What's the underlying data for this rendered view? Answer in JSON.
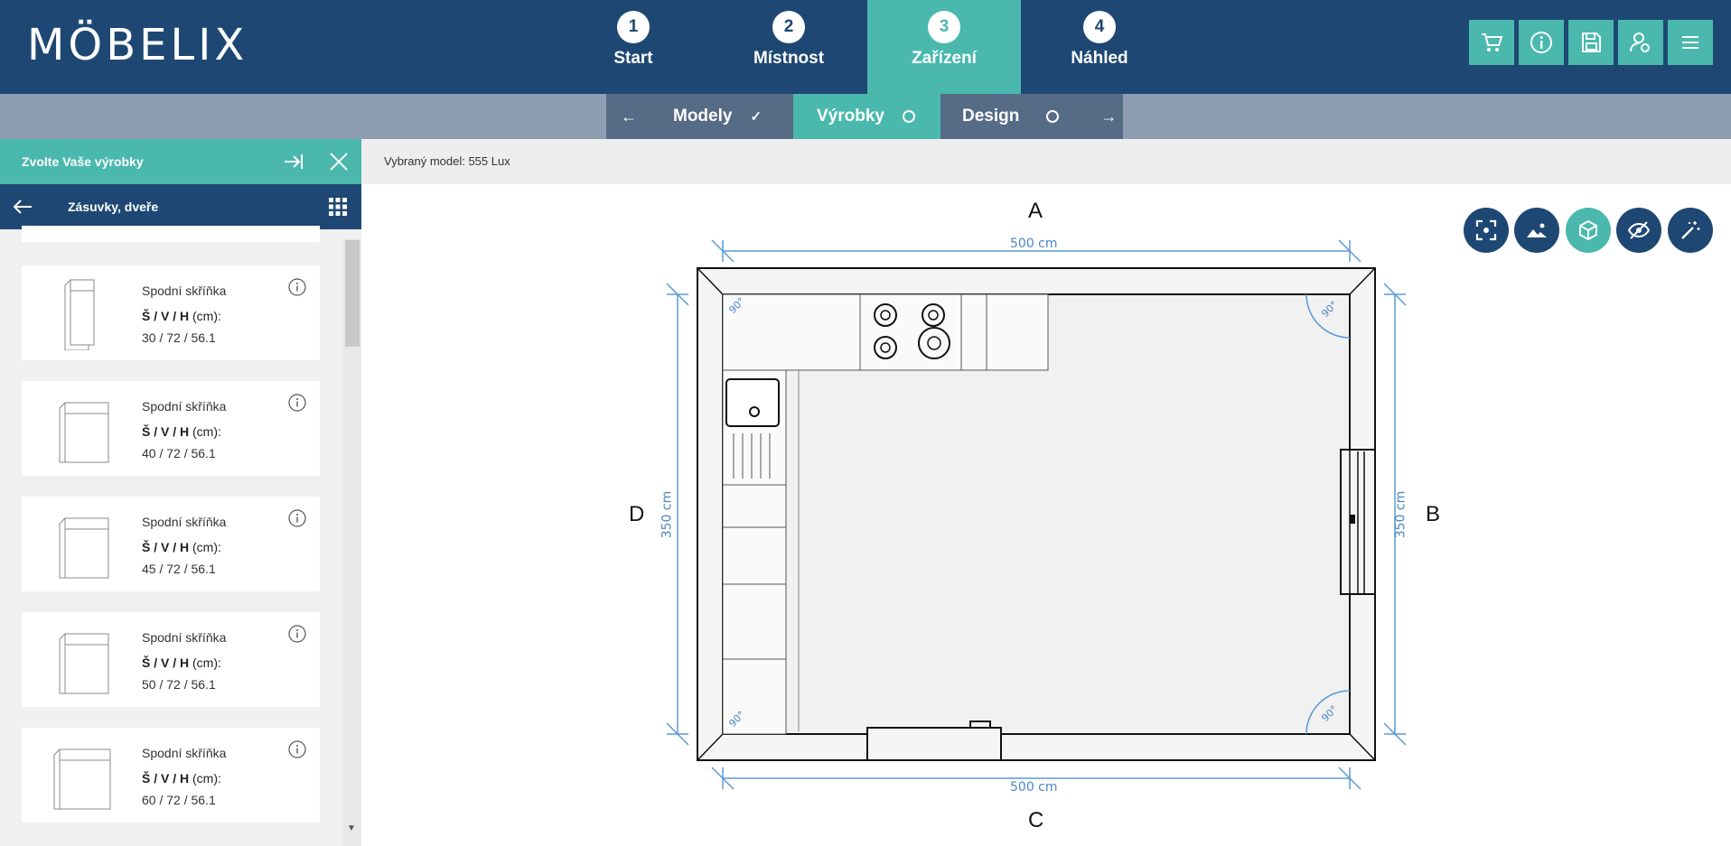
{
  "brand": {
    "logo": "MÖBELIX"
  },
  "steps": [
    {
      "number": "1",
      "label": "Start"
    },
    {
      "number": "2",
      "label": "Místnost"
    },
    {
      "number": "3",
      "label": "Zařízení"
    },
    {
      "number": "4",
      "label": "Náhled"
    }
  ],
  "toolbar": {
    "icons": [
      "cart-icon",
      "info-icon",
      "save-icon",
      "user-settings-icon",
      "menu-icon"
    ]
  },
  "subnav": {
    "models": "Modely",
    "products": "Výrobky",
    "design": "Design"
  },
  "sidebar": {
    "title": "Zvolte Vaše výrobky",
    "category": "Zásuvky, dveře",
    "products": [
      {
        "name": "Spodní skříňka",
        "dims_label": "Š / V / H",
        "dims_unit": "(cm):",
        "dims": "30 / 72 / 56.1"
      },
      {
        "name": "Spodní skříňka",
        "dims_label": "Š / V / H",
        "dims_unit": "(cm):",
        "dims": "40 / 72 / 56.1"
      },
      {
        "name": "Spodní skříňka",
        "dims_label": "Š / V / H",
        "dims_unit": "(cm):",
        "dims": "45 / 72 / 56.1"
      },
      {
        "name": "Spodní skříňka",
        "dims_label": "Š / V / H",
        "dims_unit": "(cm):",
        "dims": "50 / 72 / 56.1"
      },
      {
        "name": "Spodní skříňka",
        "dims_label": "Š / V / H",
        "dims_unit": "(cm):",
        "dims": "60 / 72 / 56.1"
      }
    ]
  },
  "main": {
    "selected_model": "Vybraný model: 555 Lux"
  },
  "plan": {
    "walls": {
      "top": "A",
      "right": "B",
      "bottom": "C",
      "left": "D"
    },
    "dims": {
      "top": "500 cm",
      "bottom": "500 cm",
      "left": "350 cm",
      "right": "350 cm"
    },
    "angle": "90°"
  },
  "colors": {
    "navy": "#1e4873",
    "teal": "#4ab8ad",
    "subbar": "#8d9db2"
  }
}
